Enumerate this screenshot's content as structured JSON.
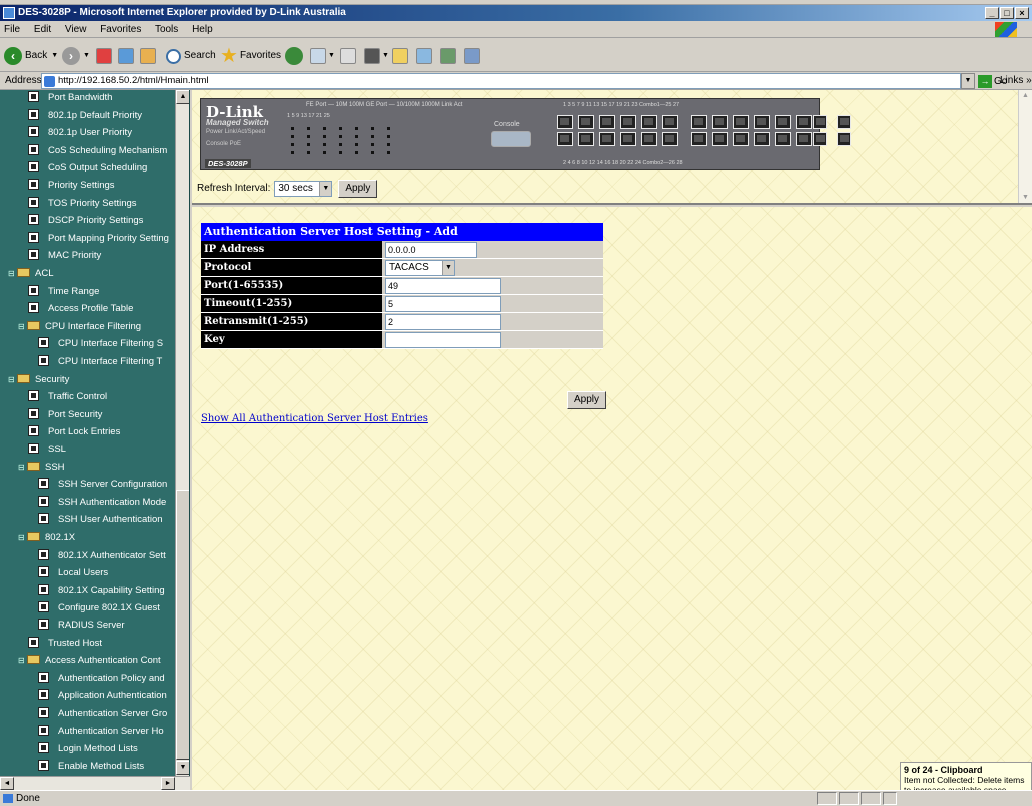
{
  "window": {
    "title": "DES-3028P - Microsoft Internet Explorer provided by D-Link Australia"
  },
  "menu": [
    "File",
    "Edit",
    "View",
    "Favorites",
    "Tools",
    "Help"
  ],
  "toolbar": {
    "back": "Back",
    "search": "Search",
    "favorites": "Favorites"
  },
  "address": {
    "label": "Address",
    "url": "http://192.168.50.2/html/Hmain.html",
    "go": "Go",
    "links": "Links"
  },
  "sidebar": {
    "items": [
      {
        "label": "Port Bandwidth",
        "type": "doc"
      },
      {
        "label": "802.1p Default Priority",
        "type": "doc"
      },
      {
        "label": "802.1p User Priority",
        "type": "doc"
      },
      {
        "label": "CoS Scheduling Mechanism",
        "type": "doc"
      },
      {
        "label": "CoS Output Scheduling",
        "type": "doc"
      },
      {
        "label": "Priority Settings",
        "type": "doc"
      },
      {
        "label": "TOS Priority Settings",
        "type": "doc"
      },
      {
        "label": "DSCP Priority Settings",
        "type": "doc"
      },
      {
        "label": "Port Mapping Priority Setting",
        "type": "doc"
      },
      {
        "label": "MAC Priority",
        "type": "doc"
      },
      {
        "label": "ACL",
        "type": "folder"
      },
      {
        "label": "Time Range",
        "type": "doc"
      },
      {
        "label": "Access Profile Table",
        "type": "doc"
      },
      {
        "label": "CPU Interface Filtering",
        "type": "folder"
      },
      {
        "label": "CPU Interface Filtering S",
        "type": "doc"
      },
      {
        "label": "CPU Interface Filtering T",
        "type": "doc"
      },
      {
        "label": "Security",
        "type": "folder"
      },
      {
        "label": "Traffic Control",
        "type": "doc"
      },
      {
        "label": "Port Security",
        "type": "doc"
      },
      {
        "label": "Port Lock Entries",
        "type": "doc"
      },
      {
        "label": "SSL",
        "type": "doc"
      },
      {
        "label": "SSH",
        "type": "folder"
      },
      {
        "label": "SSH Server Configuration",
        "type": "doc"
      },
      {
        "label": "SSH Authentication Mode",
        "type": "doc"
      },
      {
        "label": "SSH User Authentication",
        "type": "doc"
      },
      {
        "label": "802.1X",
        "type": "folder"
      },
      {
        "label": "802.1X Authenticator Sett",
        "type": "doc"
      },
      {
        "label": "Local Users",
        "type": "doc"
      },
      {
        "label": "802.1X Capability Setting",
        "type": "doc"
      },
      {
        "label": "Configure 802.1X Guest ",
        "type": "doc"
      },
      {
        "label": "RADIUS Server",
        "type": "doc"
      },
      {
        "label": "Trusted Host",
        "type": "doc"
      },
      {
        "label": "Access Authentication Cont",
        "type": "folder"
      },
      {
        "label": "Authentication Policy and",
        "type": "doc"
      },
      {
        "label": "Application Authentication",
        "type": "doc"
      },
      {
        "label": "Authentication Server Gro",
        "type": "doc"
      },
      {
        "label": "Authentication Server Ho",
        "type": "doc"
      },
      {
        "label": "Login Method Lists",
        "type": "doc"
      },
      {
        "label": "Enable Method Lists",
        "type": "doc"
      }
    ]
  },
  "device": {
    "brand": "D-Link",
    "sub": "Managed Switch",
    "model": "DES-3028P",
    "legend": "FE Port — 10M 100M   GE Port — 10/100M 1000M   Link   Act",
    "console": "Console",
    "panel_labels": "Power  Link/Act/Speed",
    "console_poe": "Console  PoE",
    "top_numbers": "1  3  5  7  9  11   13  15  17  19  21  23   Combo1—25  27",
    "bottom_numbers": "2  4  6  8  10  12   14  16  18  20  22  24   Combo2—26  28",
    "led_cols": "1  5  9  13  17  21   25"
  },
  "refresh": {
    "label": "Refresh Interval:",
    "value": "30 secs",
    "apply": "Apply"
  },
  "form": {
    "title": "Authentication Server Host Setting - Add",
    "ip_label": "IP Address",
    "ip_value": "0.0.0.0",
    "protocol_label": "Protocol",
    "protocol_value": "TACACS",
    "port_label": "Port(1-65535)",
    "port_value": "49",
    "timeout_label": "Timeout(1-255)",
    "timeout_value": "5",
    "retransmit_label": "Retransmit(1-255)",
    "retransmit_value": "2",
    "key_label": "Key",
    "key_value": "",
    "apply": "Apply"
  },
  "link_show_all": "Show All Authentication Server Host Entries",
  "status": {
    "text": "Done"
  },
  "clipboard": {
    "title": "9 of 24 - Clipboard",
    "line1": "Item not Collected: Delete items",
    "line2": "to increase available space"
  },
  "colors": {
    "sidebar": "#2f6d6a",
    "form_header": "#0000ff",
    "link": "#0000cc"
  }
}
